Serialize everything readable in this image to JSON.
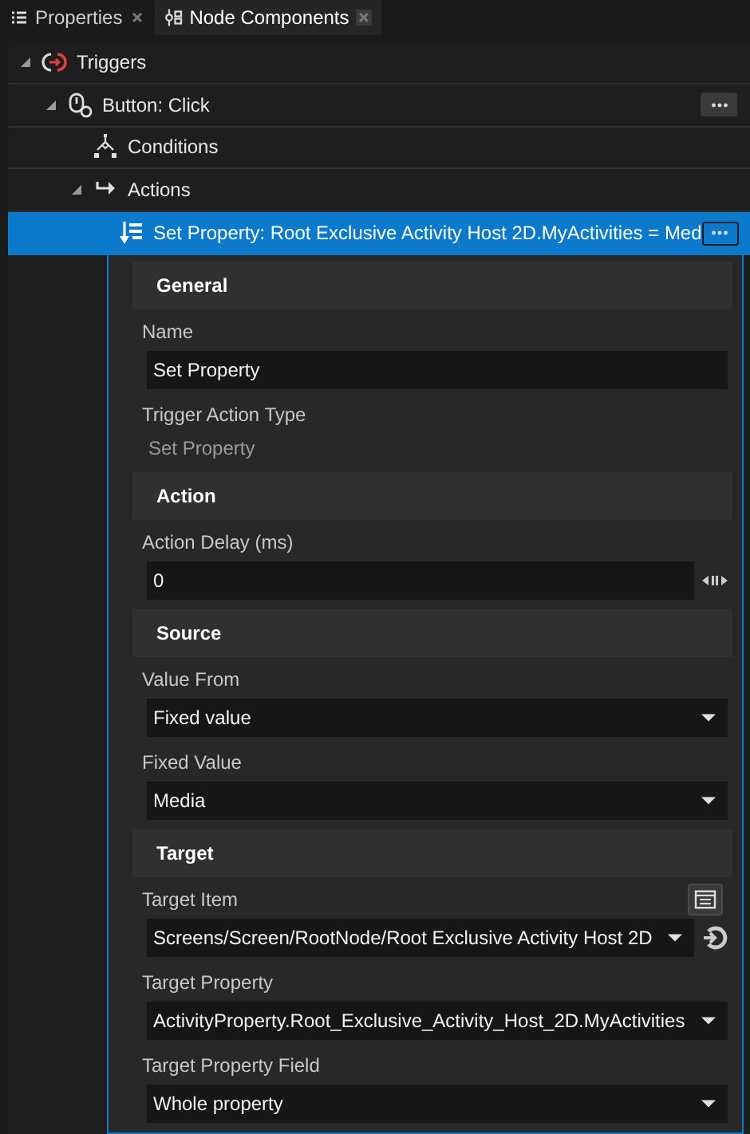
{
  "tabs": [
    {
      "label": "Properties",
      "selected": false
    },
    {
      "label": "Node Components",
      "selected": true
    }
  ],
  "tree": [
    {
      "label": "Triggers",
      "expanded": true,
      "selected": false,
      "children": [
        {
          "label": "Button: Click",
          "expanded": true,
          "selected": false,
          "has_menu": true,
          "children": [
            {
              "label": "Conditions",
              "selected": false
            },
            {
              "label": "Actions",
              "expanded": true,
              "selected": false,
              "children": [
                {
                  "label": "Set Property: Root Exclusive Activity Host 2D.MyActivities = Med",
                  "selected": true,
                  "has_menu": true
                }
              ]
            }
          ]
        }
      ]
    }
  ],
  "properties": [
    {
      "title": "General",
      "fields": [
        {
          "kind": "text",
          "label": "Name",
          "value": "Set Property"
        },
        {
          "kind": "readonly",
          "label": "Trigger Action Type",
          "value": "Set Property"
        }
      ]
    },
    {
      "title": "Action",
      "fields": [
        {
          "kind": "number",
          "label": "Action Delay (ms)",
          "value": "0"
        }
      ]
    },
    {
      "title": "Source",
      "fields": [
        {
          "kind": "dropdown",
          "label": "Value From",
          "value": "Fixed value"
        },
        {
          "kind": "dropdown",
          "label": "Fixed Value",
          "value": "Media"
        }
      ]
    },
    {
      "title": "Target",
      "fields": [
        {
          "kind": "target",
          "label": "Target Item",
          "value": "Screens/Screen/RootNode/Root Exclusive Activity Host 2D"
        },
        {
          "kind": "dropdown",
          "label": "Target Property",
          "value": "ActivityProperty.Root_Exclusive_Activity_Host_2D.MyActivities"
        },
        {
          "kind": "dropdown",
          "label": "Target Property Field",
          "value": "Whole property"
        }
      ]
    }
  ]
}
